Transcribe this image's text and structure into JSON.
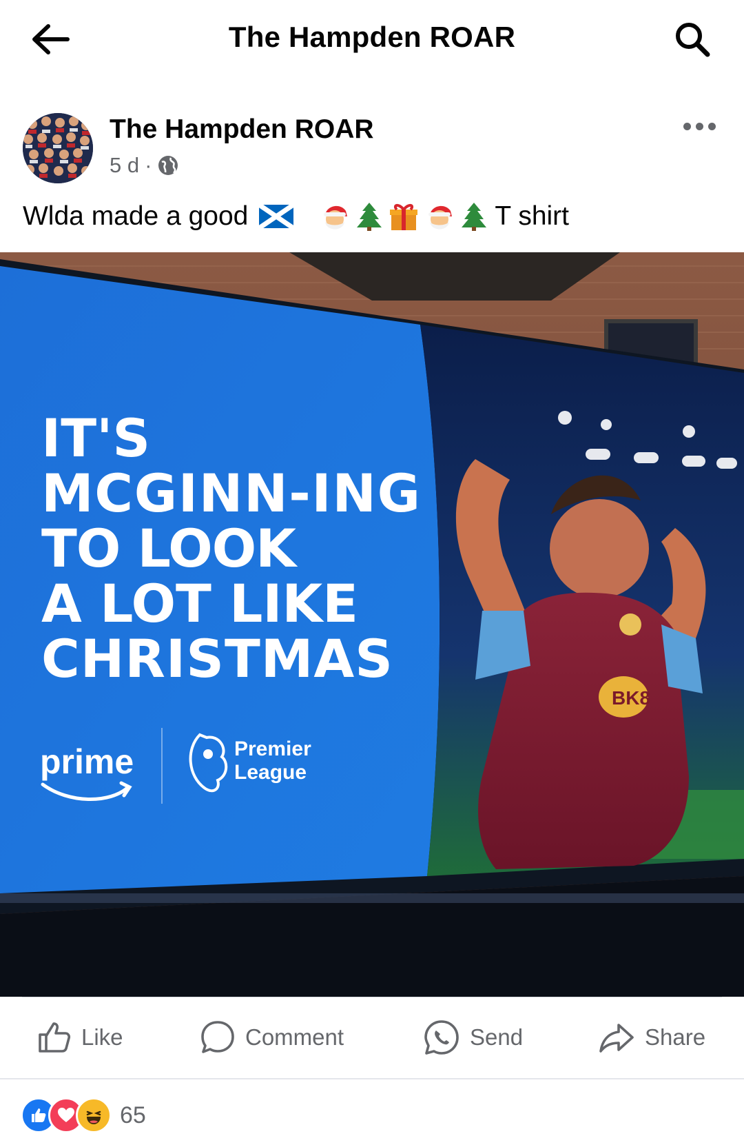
{
  "header": {
    "title": "The Hampden ROAR",
    "back_icon": "arrow-left-icon",
    "search_icon": "search-icon"
  },
  "post": {
    "author": "The Hampden ROAR",
    "time": "5 d",
    "separator": "·",
    "audience_icon": "globe-icon",
    "text_before": "Wlda made a good",
    "text_after": "T shirt",
    "emojis": [
      "🏴",
      "🎅",
      "🎄",
      "🎁",
      "🎅",
      "🎄"
    ],
    "image": {
      "headline": [
        "IT'S",
        "MCGINN-ING",
        "TO LOOK",
        "A LOT LIKE",
        "CHRISTMAS"
      ],
      "logo_prime": "prime",
      "logo_league_line1": "Premier",
      "logo_league_line2": "League",
      "shirt_text": "BK8"
    }
  },
  "actions": {
    "like": "Like",
    "comment": "Comment",
    "send": "Send",
    "share": "Share"
  },
  "reactions": {
    "types": [
      "like",
      "love",
      "haha"
    ],
    "count": "65"
  },
  "colors": {
    "facebook_blue": "#1877f2",
    "love_red": "#f33e58",
    "haha_yellow": "#f7b928",
    "billboard_blue": "#1c72d6"
  }
}
